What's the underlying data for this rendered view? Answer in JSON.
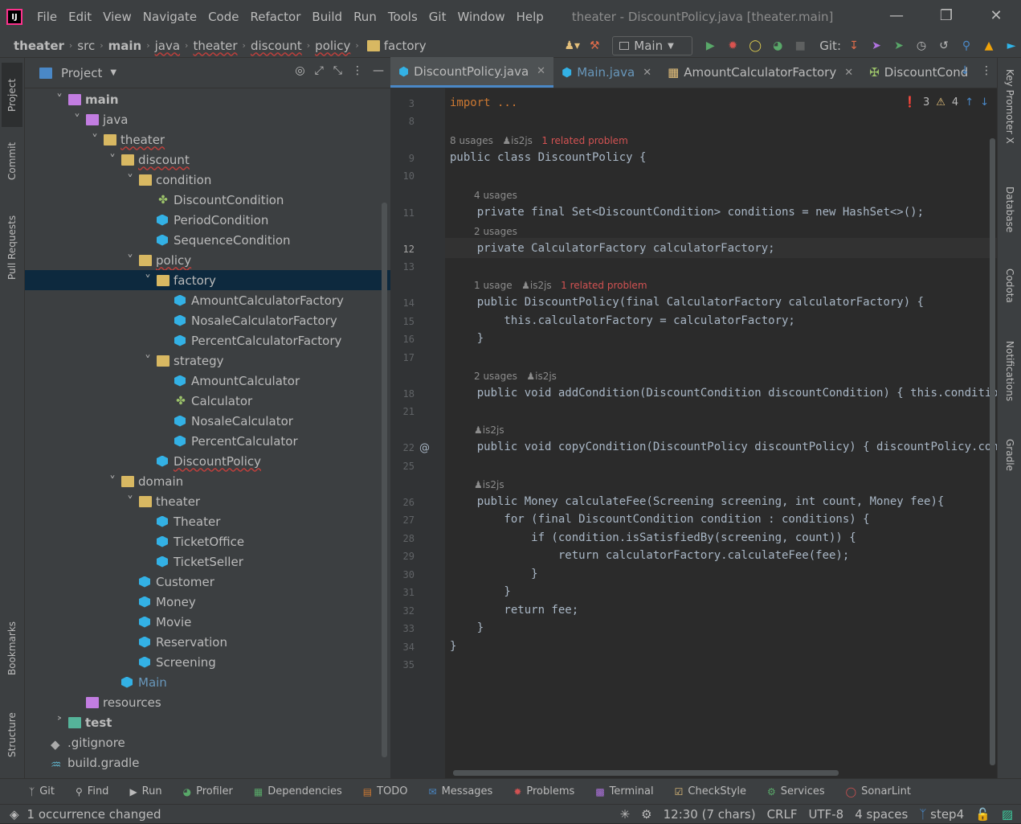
{
  "app": {
    "logo": "IJ",
    "menu": [
      "File",
      "Edit",
      "View",
      "Navigate",
      "Code",
      "Refactor",
      "Build",
      "Run",
      "Tools",
      "Git",
      "Window",
      "Help"
    ],
    "window_title": "theater - DiscountPolicy.java [theater.main]",
    "window_buttons": [
      "—",
      "❐",
      "✕"
    ]
  },
  "breadcrumb": [
    "theater",
    "src",
    "main",
    "java",
    "theater",
    "discount",
    "policy",
    "factory"
  ],
  "toolbar": {
    "run_config": "Main",
    "git_label": "Git:"
  },
  "left_strip": [
    "Project",
    "Commit",
    "Pull Requests",
    "Bookmarks",
    "Structure"
  ],
  "right_strip": [
    "Key Promoter X",
    "Database",
    "Codota",
    "Notifications",
    "Gradle"
  ],
  "project_panel": {
    "title": "Project",
    "tree": [
      {
        "label": "main",
        "depth": 2,
        "kind": "folder-src",
        "expanded": true,
        "bold": true
      },
      {
        "label": "java",
        "depth": 3,
        "kind": "folder-src",
        "expanded": true
      },
      {
        "label": "theater",
        "depth": 4,
        "kind": "pkg",
        "expanded": true
      },
      {
        "label": "discount",
        "depth": 5,
        "kind": "pkg",
        "expanded": true
      },
      {
        "label": "condition",
        "depth": 6,
        "kind": "pkg",
        "expanded": true
      },
      {
        "label": "DiscountCondition",
        "depth": 7,
        "kind": "interface"
      },
      {
        "label": "PeriodCondition",
        "depth": 7,
        "kind": "class"
      },
      {
        "label": "SequenceCondition",
        "depth": 7,
        "kind": "class"
      },
      {
        "label": "policy",
        "depth": 6,
        "kind": "pkg",
        "expanded": true
      },
      {
        "label": "factory",
        "depth": 7,
        "kind": "pkg",
        "expanded": true,
        "selected": true
      },
      {
        "label": "AmountCalculatorFactory",
        "depth": 8,
        "kind": "class"
      },
      {
        "label": "NosaleCalculatorFactory",
        "depth": 8,
        "kind": "class"
      },
      {
        "label": "PercentCalculatorFactory",
        "depth": 8,
        "kind": "class"
      },
      {
        "label": "strategy",
        "depth": 7,
        "kind": "pkg",
        "expanded": true
      },
      {
        "label": "AmountCalculator",
        "depth": 8,
        "kind": "class"
      },
      {
        "label": "Calculator",
        "depth": 8,
        "kind": "interface"
      },
      {
        "label": "NosaleCalculator",
        "depth": 8,
        "kind": "class"
      },
      {
        "label": "PercentCalculator",
        "depth": 8,
        "kind": "class"
      },
      {
        "label": "DiscountPolicy",
        "depth": 7,
        "kind": "class"
      },
      {
        "label": "domain",
        "depth": 5,
        "kind": "pkg",
        "expanded": true
      },
      {
        "label": "theater",
        "depth": 6,
        "kind": "pkg",
        "expanded": true
      },
      {
        "label": "Theater",
        "depth": 7,
        "kind": "class"
      },
      {
        "label": "TicketOffice",
        "depth": 7,
        "kind": "class"
      },
      {
        "label": "TicketSeller",
        "depth": 7,
        "kind": "class"
      },
      {
        "label": "Customer",
        "depth": 6,
        "kind": "class"
      },
      {
        "label": "Money",
        "depth": 6,
        "kind": "class"
      },
      {
        "label": "Movie",
        "depth": 6,
        "kind": "class"
      },
      {
        "label": "Reservation",
        "depth": 6,
        "kind": "class"
      },
      {
        "label": "Screening",
        "depth": 6,
        "kind": "class"
      },
      {
        "label": "Main",
        "depth": 5,
        "kind": "class"
      },
      {
        "label": "resources",
        "depth": 3,
        "kind": "folder-res"
      },
      {
        "label": "test",
        "depth": 2,
        "kind": "folder-test",
        "expanded": false,
        "bold": true
      },
      {
        "label": ".gitignore",
        "depth": 1,
        "kind": "file"
      },
      {
        "label": "build.gradle",
        "depth": 1,
        "kind": "gradle"
      }
    ]
  },
  "editor": {
    "tabs": [
      {
        "label": "DiscountPolicy.java",
        "active": true,
        "closable": true
      },
      {
        "label": "Main.java",
        "closable": true
      },
      {
        "label": "AmountCalculatorFactory",
        "closable": true
      },
      {
        "label": "DiscountCond",
        "closable": false
      }
    ],
    "inspections": {
      "errors": "3",
      "warnings": "4"
    },
    "line_numbers": [
      "3",
      "8",
      "9",
      "10",
      "11",
      "12",
      "13",
      "14",
      "15",
      "16",
      "17",
      "18",
      "21",
      "22",
      "25",
      "26",
      "27",
      "28",
      "29",
      "30",
      "31",
      "32",
      "33",
      "34",
      "35"
    ],
    "hints": {
      "h1": "8 usages",
      "h1_author": "is2js",
      "h1_prob": "1 related problem",
      "h2": "4 usages",
      "h3": "2 usages",
      "h4": "1 usage",
      "h4_author": "is2js",
      "h4_prob": "1 related problem",
      "h5": "2 usages",
      "h5_author": "is2js",
      "h6_author": "is2js",
      "h7_author": "is2js"
    },
    "code": {
      "l3": "import ...",
      "l9": "public class DiscountPolicy {",
      "l11": "    private final Set<DiscountCondition> conditions = new HashSet<>();",
      "l12": "    private CalculatorFactory calculatorFactory;",
      "l14": "    public DiscountPolicy(final CalculatorFactory calculatorFactory) {",
      "l15": "        this.calculatorFactory = calculatorFactory;",
      "l16": "    }",
      "l18": "    public void addCondition(DiscountCondition discountCondition) { this.conditions.a",
      "l22": "    public void copyCondition(DiscountPolicy discountPolicy) { discountPolicy.conditi",
      "l26": "    public Money calculateFee(Screening screening, int count, Money fee){",
      "l27": "        for (final DiscountCondition condition : conditions) {",
      "l28": "            if (condition.isSatisfiedBy(screening, count)) {",
      "l29": "                return calculatorFactory.calculateFee(fee);",
      "l30": "            }",
      "l31": "        }",
      "l32": "        return fee;",
      "l33": "    }",
      "l34": "}"
    }
  },
  "bottom_tools": [
    "Git",
    "Find",
    "Run",
    "Profiler",
    "Dependencies",
    "TODO",
    "Messages",
    "Problems",
    "Terminal",
    "CheckStyle",
    "Services",
    "SonarLint"
  ],
  "status": {
    "message": "1 occurrence changed",
    "position": "12:30 (7 chars)",
    "line_sep": "CRLF",
    "encoding": "UTF-8",
    "indent": "4 spaces",
    "branch": "step4"
  },
  "colors": {
    "accent": "#4a88c7",
    "keyword": "#cc7832",
    "field": "#9876aa",
    "method": "#ffc66d",
    "error": "#d25252"
  }
}
